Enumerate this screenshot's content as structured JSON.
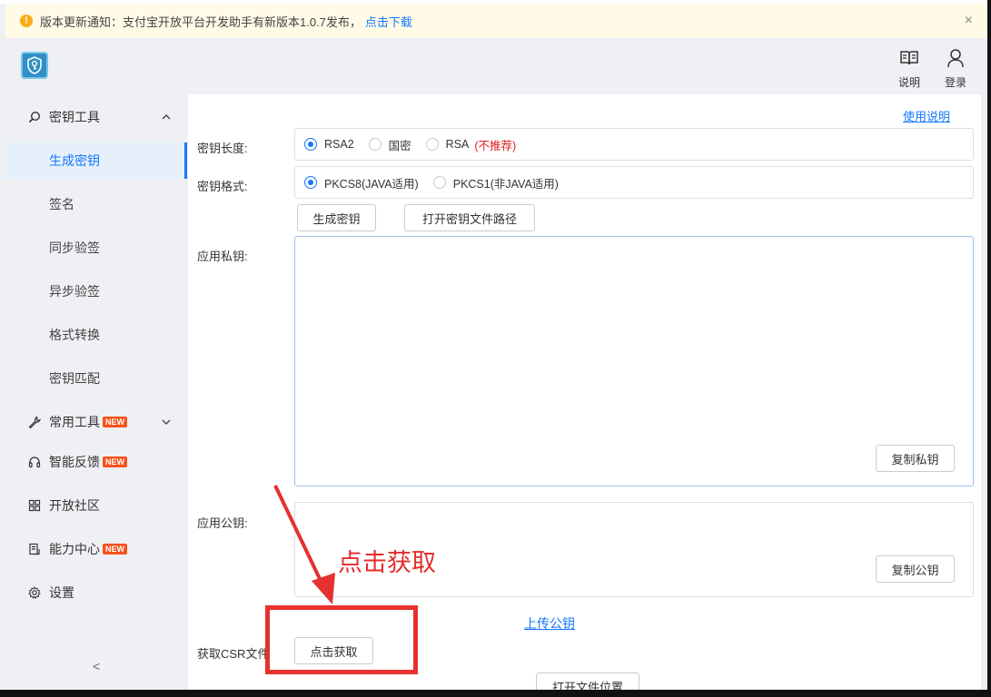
{
  "notice": {
    "text": "版本更新通知：支付宝开放平台开发助手有新版本1.0.7发布，",
    "link": "点击下载",
    "close": "×"
  },
  "header": {
    "help_label": "说明",
    "login_label": "登录"
  },
  "sidebar": {
    "key_tools": "密钥工具",
    "sub_items": [
      "生成密钥",
      "签名",
      "同步验签",
      "异步验签",
      "格式转换",
      "密钥匹配"
    ],
    "common_tools": "常用工具",
    "feedback": "智能反馈",
    "community": "开放社区",
    "capability": "能力中心",
    "settings": "设置",
    "badge": "NEW",
    "collapse": "<"
  },
  "content": {
    "usage_link": "使用说明",
    "key_length_label": "密钥长度:",
    "key_length_options": [
      "RSA2",
      "国密",
      "RSA"
    ],
    "not_recommended": "(不推荐)",
    "key_format_label": "密钥格式:",
    "key_format_options": [
      "PKCS8(JAVA适用)",
      "PKCS1(非JAVA适用)"
    ],
    "generate_btn": "生成密钥",
    "open_path_btn": "打开密钥文件路径",
    "private_key_label": "应用私钥:",
    "copy_private_btn": "复制私钥",
    "public_key_label": "应用公钥:",
    "copy_public_btn": "复制公钥",
    "upload_link": "上传公钥",
    "csr_label": "获取CSR文件",
    "csr_btn": "点击获取",
    "open_file_btn": "打开文件位置"
  },
  "annotation": {
    "text": "点击获取",
    "color": "#e5312f"
  }
}
